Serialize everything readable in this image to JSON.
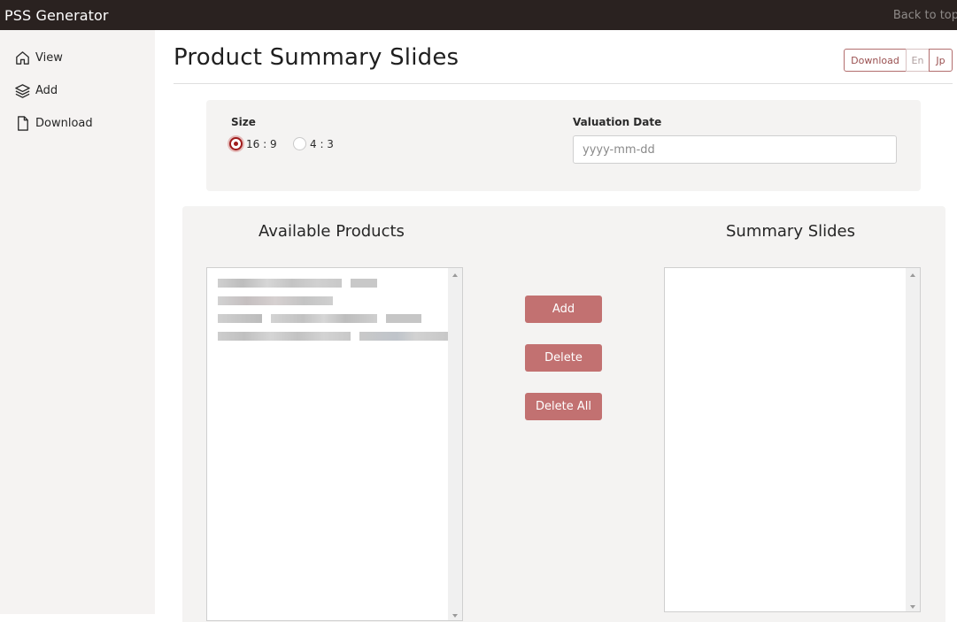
{
  "app": {
    "title": "PSS Generator",
    "back_to_top": "Back to top"
  },
  "sidebar": {
    "items": [
      {
        "label": "View",
        "icon": "home-icon"
      },
      {
        "label": "Add",
        "icon": "layers-icon"
      },
      {
        "label": "Download",
        "icon": "file-icon"
      }
    ]
  },
  "header": {
    "title": "Product Summary Slides",
    "download_label": "Download",
    "lang_en": "En",
    "lang_jp": "Jp"
  },
  "settings": {
    "size_label": "Size",
    "size_options": [
      "16 : 9",
      "4 : 3"
    ],
    "size_selected": "16 : 9",
    "valuation_label": "Valuation Date",
    "valuation_placeholder": "yyyy-mm-dd",
    "valuation_value": ""
  },
  "products": {
    "available_title": "Available Products",
    "summary_title": "Summary Slides",
    "available_items_count_visible": 4,
    "summary_items": []
  },
  "actions": {
    "add": "Add",
    "delete": "Delete",
    "delete_all": "Delete All"
  },
  "colors": {
    "topbar": "#2a2220",
    "accent": "#c27171",
    "accent_dark": "#a01c1c",
    "panel_bg": "#f4f3f2"
  }
}
